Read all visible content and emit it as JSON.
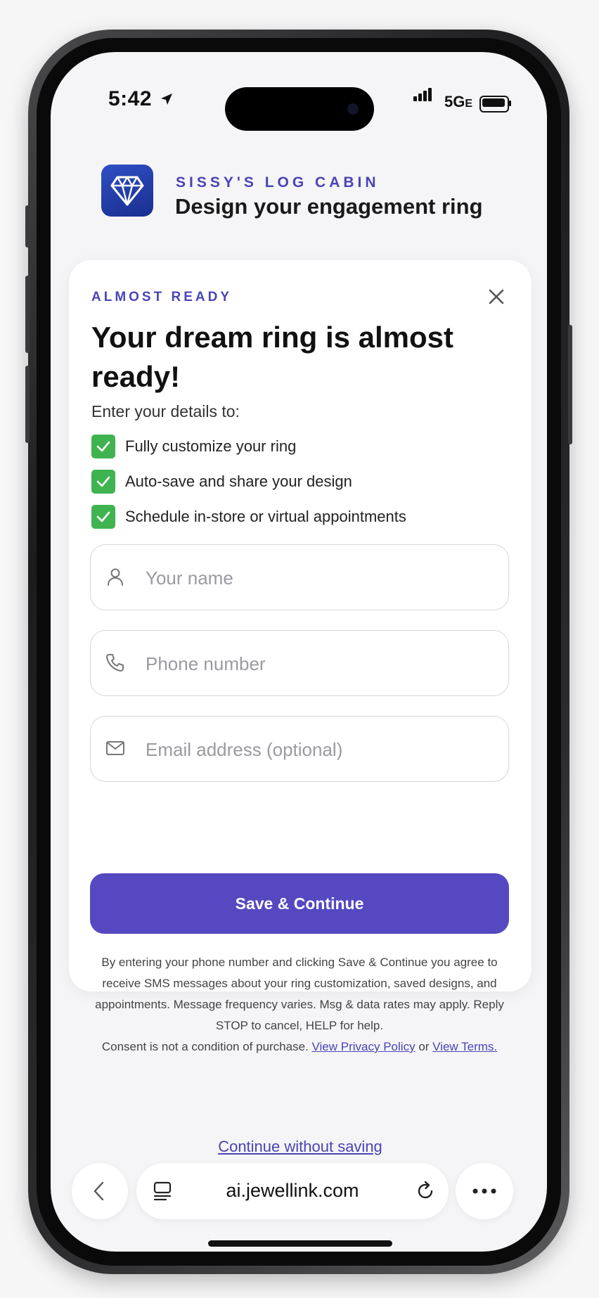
{
  "status_bar": {
    "time": "5:42",
    "network": "5G",
    "network_suffix": "E"
  },
  "header": {
    "brand": "SISSY'S LOG CABIN",
    "title": "Design your engagement ring",
    "icon": "diamond-icon"
  },
  "modal": {
    "eyebrow": "ALMOST READY",
    "title": "Your dream ring is almost ready!",
    "intro": "Enter your details to:",
    "benefits": [
      "Fully customize your ring",
      "Auto-save and share your design",
      "Schedule in-store or virtual appointments"
    ],
    "fields": {
      "name_placeholder": "Your name",
      "phone_placeholder": "Phone number",
      "email_placeholder": "Email address (optional)"
    },
    "save_label": "Save & Continue",
    "legal_text": "By entering your phone number and clicking Save & Continue you agree to receive SMS messages about your ring customization, saved designs, and appointments. Message frequency varies. Msg & data rates may apply. Reply STOP to cancel, HELP for help.",
    "consent_text": "Consent is not a condition of purchase.",
    "privacy_link": "View Privacy Policy",
    "or_text": "or",
    "terms_link": "View Terms.",
    "skip_label": "Continue without saving"
  },
  "browser": {
    "url": "ai.jewellink.com"
  },
  "colors": {
    "accent": "#5548c0",
    "check": "#3fb34f",
    "brand_text": "#4a44b5"
  }
}
